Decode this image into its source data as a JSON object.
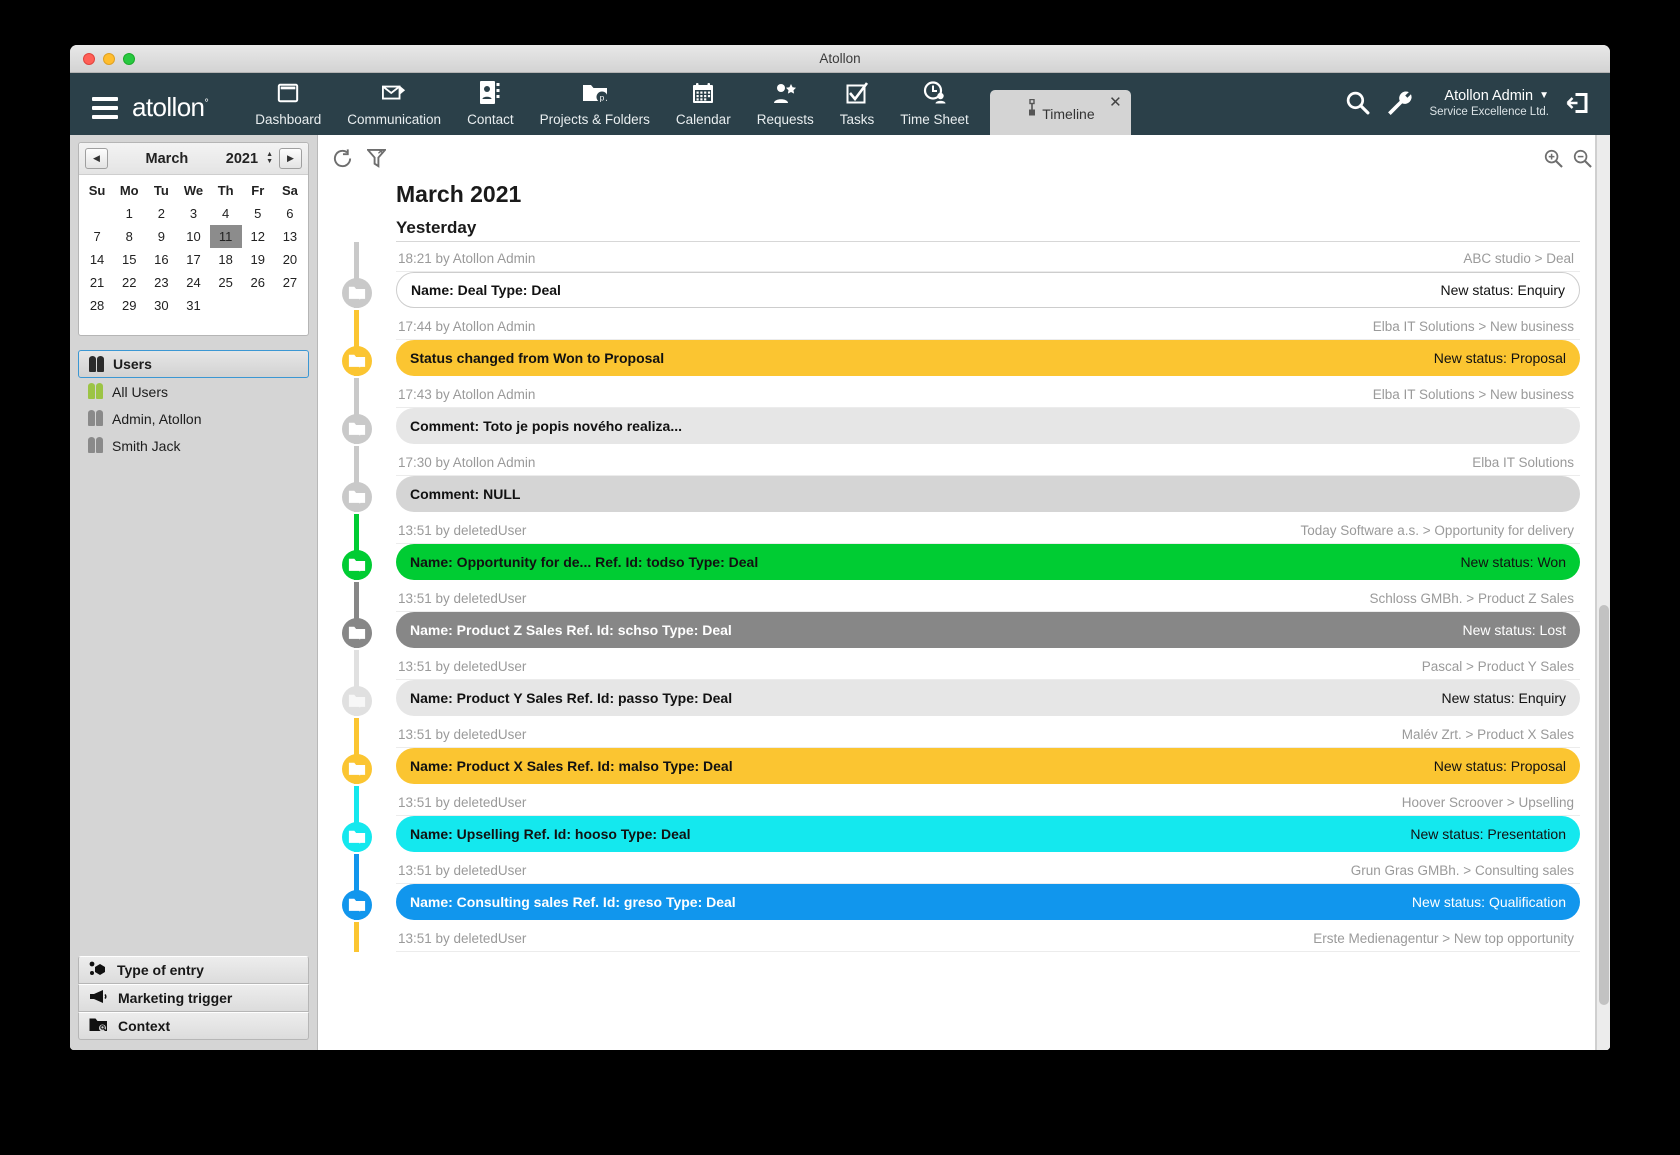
{
  "window": {
    "title": "Atollon"
  },
  "topnav": {
    "brand": "atollon",
    "brand_mark": "°",
    "items": [
      {
        "label": "Dashboard",
        "icon": "dashboard-icon"
      },
      {
        "label": "Communication",
        "icon": "envelope-icon"
      },
      {
        "label": "Contact",
        "icon": "contact-card-icon"
      },
      {
        "label": "Projects & Folders",
        "icon": "folder-p-icon"
      },
      {
        "label": "Calendar",
        "icon": "calendar-icon"
      },
      {
        "label": "Requests",
        "icon": "person-star-icon"
      },
      {
        "label": "Tasks",
        "icon": "checkbox-check-icon"
      },
      {
        "label": "Time Sheet",
        "icon": "clock-person-icon"
      }
    ],
    "active_tab": {
      "label": "Timeline",
      "icon": "timeline-icon",
      "close": "✕"
    },
    "search_icon": "search-icon",
    "settings_icon": "wrench-icon",
    "logout_icon": "logout-icon",
    "user": {
      "name": "Atollon Admin",
      "company": "Service Excellence Ltd.",
      "caret": "▼"
    }
  },
  "sidebar": {
    "calendar": {
      "prev": "◀",
      "next": "▶",
      "month": "March",
      "year": "2021",
      "weekdays": [
        "Su",
        "Mo",
        "Tu",
        "We",
        "Th",
        "Fr",
        "Sa"
      ],
      "weeks": [
        [
          "",
          "1",
          "2",
          "3",
          "4",
          "5",
          "6"
        ],
        [
          "7",
          "8",
          "9",
          "10",
          "11",
          "12",
          "13"
        ],
        [
          "14",
          "15",
          "16",
          "17",
          "18",
          "19",
          "20"
        ],
        [
          "21",
          "22",
          "23",
          "24",
          "25",
          "26",
          "27"
        ],
        [
          "28",
          "29",
          "30",
          "31",
          "",
          "",
          ""
        ]
      ],
      "selected_day": "11"
    },
    "users_header": {
      "label": "Users",
      "icon": "users-icon"
    },
    "users": [
      {
        "label": "All Users",
        "icon": "users-icon-green"
      },
      {
        "label": "Admin, Atollon",
        "icon": "users-icon-gray"
      },
      {
        "label": "Smith  Jack",
        "icon": "users-icon-gray"
      }
    ],
    "bottom_buttons": [
      {
        "label": "Type of entry",
        "icon": "nodes-icon"
      },
      {
        "label": "Marketing trigger",
        "icon": "megaphone-icon"
      },
      {
        "label": "Context",
        "icon": "folder-search-icon"
      }
    ]
  },
  "toolbar": {
    "refresh_icon": "refresh-icon",
    "filter_icon": "filter-icon",
    "zoom_in_icon": "zoom-in-icon",
    "zoom_out_icon": "zoom-out-icon"
  },
  "timeline": {
    "month_title": "March 2021",
    "day_title": "Yesterday",
    "entries": [
      {
        "time": "18:21 by Atollon Admin",
        "context": "ABC studio > Deal",
        "text": "Name: Deal  Type: Deal",
        "status": "New status: Enquiry",
        "bar_style": "white",
        "node_style": "gray",
        "node_icon": "folder-p-icon"
      },
      {
        "time": "17:44 by Atollon Admin",
        "context": "Elba IT Solutions > New business",
        "text": "Status changed from Won to Proposal",
        "status": "New status: Proposal",
        "bar_style": "yellow",
        "node_style": "yellow",
        "node_icon": "folder-p-icon"
      },
      {
        "time": "17:43 by Atollon Admin",
        "context": "Elba IT Solutions > New business",
        "text": "Comment: Toto je popis nového realiza...",
        "status": "",
        "bar_style": "lgray",
        "node_style": "gray2",
        "node_icon": "folder-p-icon"
      },
      {
        "time": "17:30 by Atollon Admin",
        "context": "Elba IT Solutions",
        "text": "Comment: NULL",
        "status": "",
        "bar_style": "mgray",
        "node_style": "gray2",
        "node_icon": "folder-p-icon"
      },
      {
        "time": "13:51 by deletedUser",
        "context": "Today Software a.s. > Opportunity for delivery",
        "text": "Name: Opportunity for de...  Ref. Id: todso  Type: Deal",
        "status": "New status: Won",
        "bar_style": "green",
        "node_style": "green",
        "node_icon": "folder-p-icon"
      },
      {
        "time": "13:51 by deletedUser",
        "context": "Schloss GMBh. > Product Z Sales",
        "text": "Name: Product Z Sales  Ref. Id: schso  Type: Deal",
        "status": "New status: Lost",
        "bar_style": "dgray",
        "node_style": "dgray",
        "node_icon": "folder-p-icon"
      },
      {
        "time": "13:51 by deletedUser",
        "context": "Pascal > Product Y Sales",
        "text": "Name: Product Y Sales  Ref. Id: passo  Type: Deal",
        "status": "New status: Enquiry",
        "bar_style": "lgray",
        "node_style": "lgray",
        "node_icon": "folder-p-icon"
      },
      {
        "time": "13:51 by deletedUser",
        "context": "Malév Zrt. > Product X Sales",
        "text": "Name: Product X Sales  Ref. Id: malso  Type: Deal",
        "status": "New status: Proposal",
        "bar_style": "yellow",
        "node_style": "yellow",
        "node_icon": "folder-p-icon"
      },
      {
        "time": "13:51 by deletedUser",
        "context": "Hoover Scroover > Upselling",
        "text": "Name: Upselling  Ref. Id: hooso  Type: Deal",
        "status": "New status: Presentation",
        "bar_style": "cyan",
        "node_style": "cyan",
        "node_icon": "folder-p-icon"
      },
      {
        "time": "13:51 by deletedUser",
        "context": "Grun Gras GMBh. > Consulting sales",
        "text": "Name: Consulting sales  Ref. Id: greso  Type: Deal",
        "status": "New status: Qualification",
        "bar_style": "blue",
        "node_style": "blue",
        "node_icon": "folder-p-icon"
      },
      {
        "time": "13:51 by deletedUser",
        "context": "Erste Medienagentur > New top opportunity",
        "text": "",
        "status": "",
        "bar_style": "clipped",
        "node_style": "yellow",
        "node_icon": "folder-p-icon"
      }
    ]
  },
  "colors": {
    "nav_bg": "#2b4049",
    "yellow": "#fbc531",
    "green": "#00cc33",
    "cyan": "#14e8ee",
    "blue": "#1196ed",
    "dark_gray": "#878787",
    "accent_border": "#3b97d3"
  }
}
